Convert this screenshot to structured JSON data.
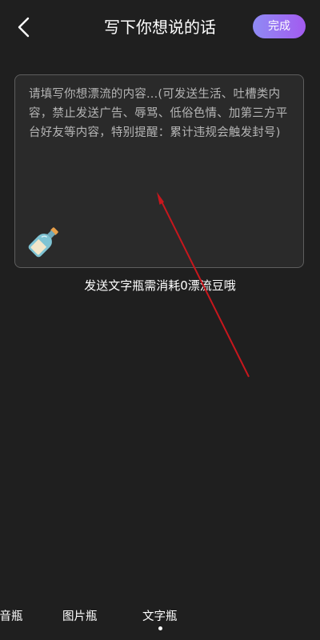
{
  "header": {
    "title": "写下你想说的话",
    "done_label": "完成"
  },
  "editor": {
    "placeholder": "请填写你想漂流的内容...(可发送生活、吐槽类内容，禁止发送广告、辱骂、低俗色情、加第三方平台好友等内容，特别提醒：累计违规会触发封号)"
  },
  "cost_hint": "发送文字瓶需消耗0漂流豆哦",
  "tabs": [
    {
      "label": "语音瓶"
    },
    {
      "label": "图片瓶"
    },
    {
      "label": "文字瓶",
      "active": true
    }
  ],
  "colors": {
    "background": "#1f1f1f",
    "card": "#2a2a2a",
    "accent_start": "#8f8bf4",
    "accent_end": "#a35bf0",
    "annotation": "#c8171d"
  },
  "icons": {
    "back": "chevron-left-icon",
    "bottle": "bottle-icon"
  }
}
